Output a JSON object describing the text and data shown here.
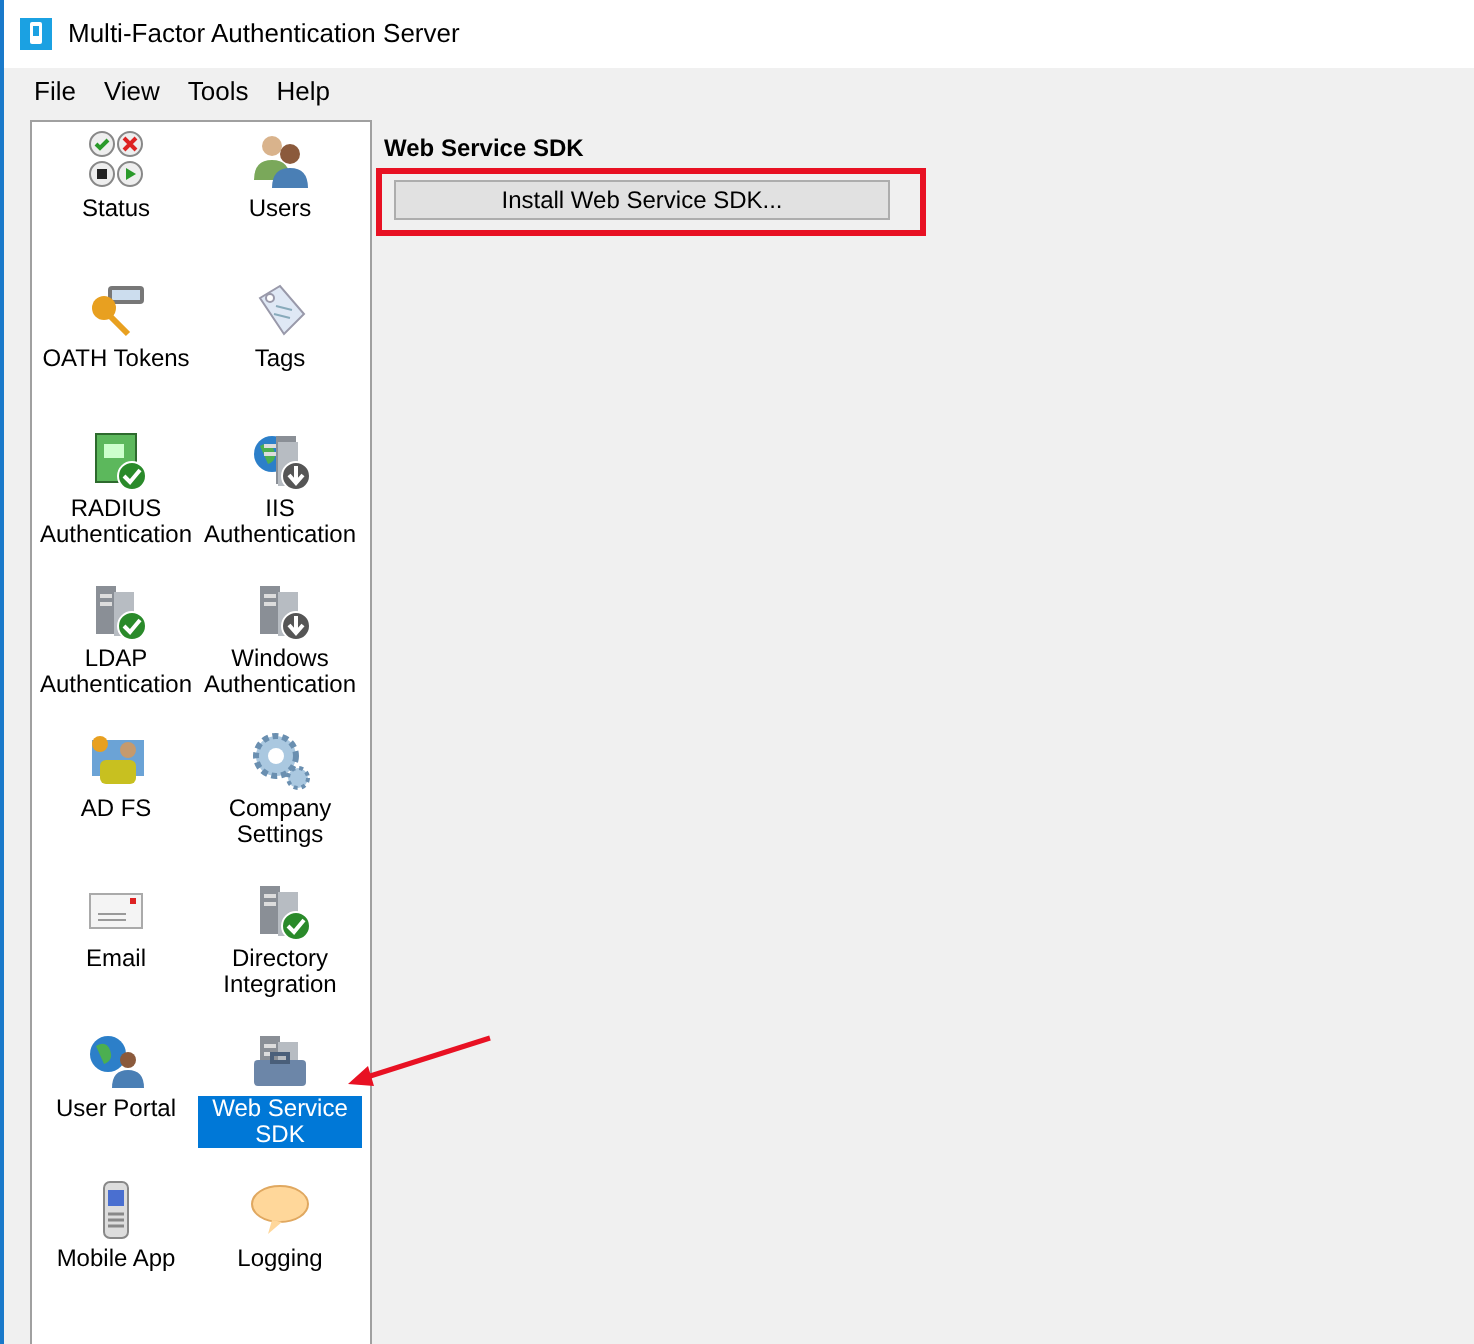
{
  "window": {
    "title": "Multi-Factor Authentication Server"
  },
  "menu": [
    "File",
    "View",
    "Tools",
    "Help"
  ],
  "sidebar": {
    "items": [
      {
        "label": "Status",
        "selected": false
      },
      {
        "label": "Users",
        "selected": false
      },
      {
        "label": "OATH Tokens",
        "selected": false
      },
      {
        "label": "Tags",
        "selected": false
      },
      {
        "label": "RADIUS Authentication",
        "selected": false
      },
      {
        "label": "IIS Authentication",
        "selected": false
      },
      {
        "label": "LDAP Authentication",
        "selected": false
      },
      {
        "label": "Windows Authentication",
        "selected": false
      },
      {
        "label": "AD FS",
        "selected": false
      },
      {
        "label": "Company Settings",
        "selected": false
      },
      {
        "label": "Email",
        "selected": false
      },
      {
        "label": "Directory Integration",
        "selected": false
      },
      {
        "label": "User Portal",
        "selected": false
      },
      {
        "label": "Web Service SDK",
        "selected": true
      },
      {
        "label": "Mobile App",
        "selected": false
      },
      {
        "label": "Logging",
        "selected": false
      }
    ]
  },
  "content": {
    "heading": "Web Service SDK",
    "button": "Install Web Service SDK..."
  }
}
